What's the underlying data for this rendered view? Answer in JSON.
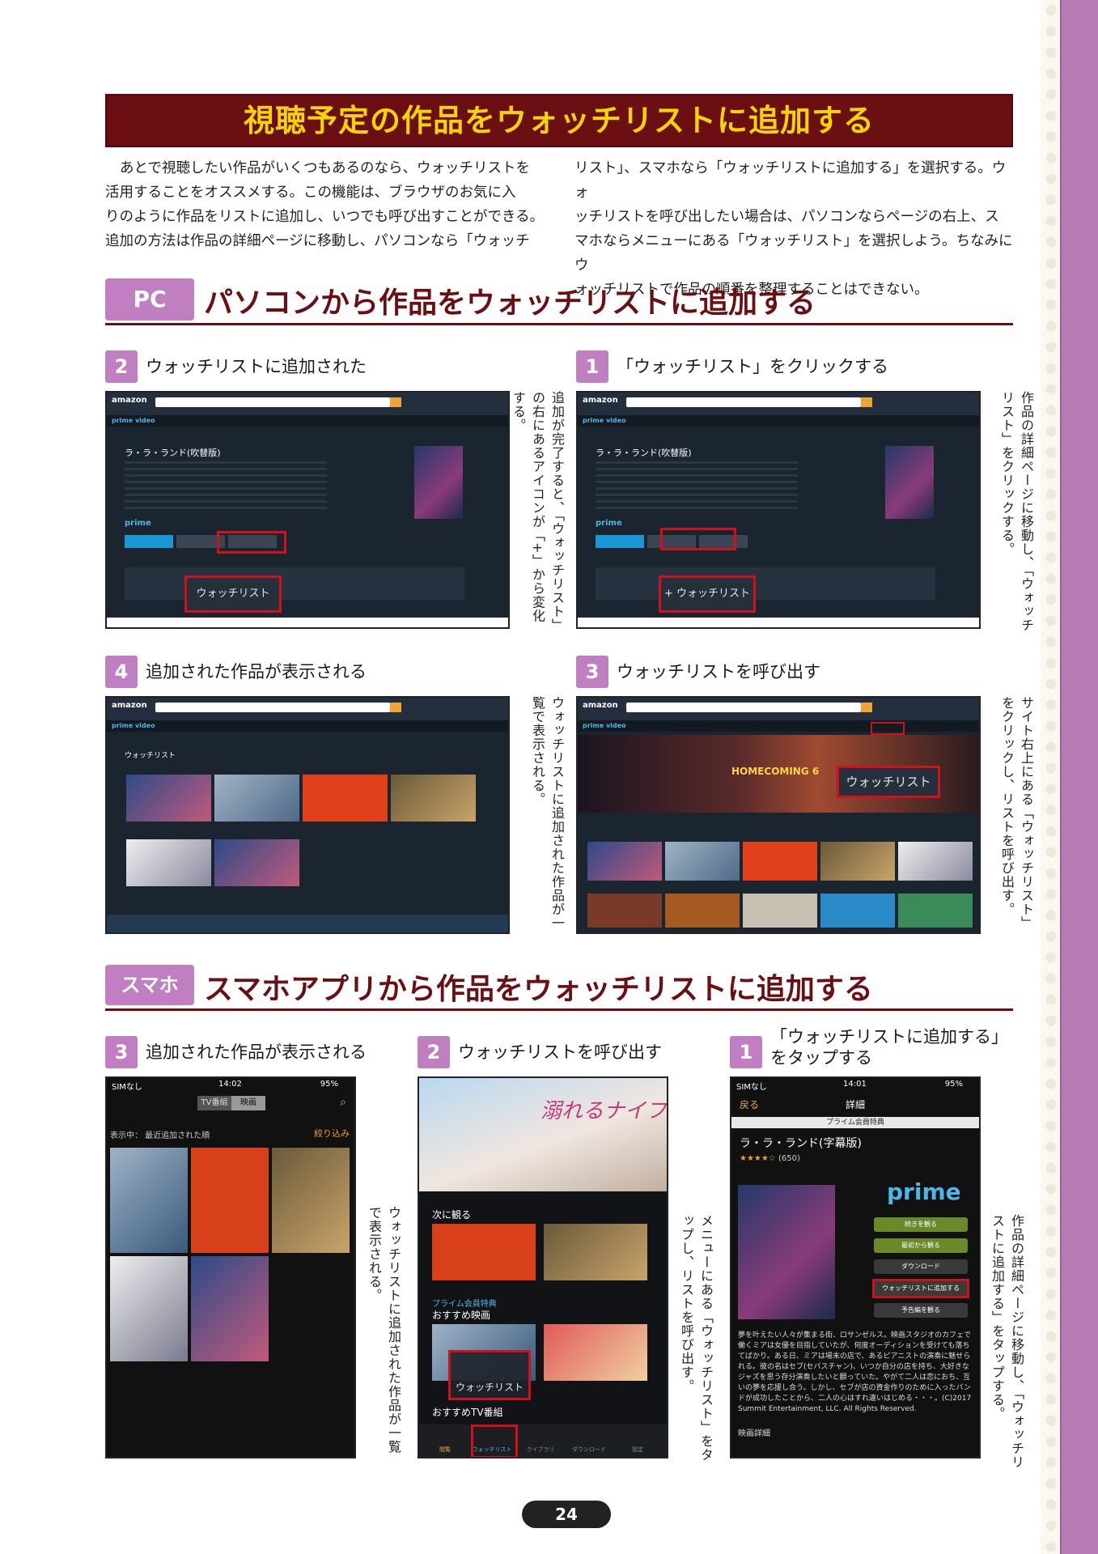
{
  "colors": {
    "banner_bg": "#6b0f13",
    "banner_text": "#f5d500",
    "badge": "#c07fc0",
    "accent_red": "#d0101a",
    "right_band": "#b77bb6"
  },
  "header": {
    "title": "視聴予定の作品をウォッチリストに追加する"
  },
  "intro": {
    "left": [
      "あとで視聴したい作品がいくつもあるのなら、ウォッチリストを",
      "活用することをオススメする。この機能は、ブラウザのお気に入",
      "りのように作品をリストに追加し、いつでも呼び出すことができる。",
      "追加の方法は作品の詳細ページに移動し、パソコンなら「ウォッチ"
    ],
    "right": [
      "リスト」、スマホなら「ウォッチリストに追加する」を選択する。ウォ",
      "ッチリストを呼び出したい場合は、パソコンならページの右上、ス",
      "マホならメニューにある「ウォッチリスト」を選択しよう。ちなみにウ",
      "ォッチリストで作品の順番を整理することはできない。"
    ]
  },
  "pc_section": {
    "badge": "PC",
    "title": "パソコンから作品をウォッチリストに追加する",
    "steps": [
      {
        "num": "1",
        "label": "「ウォッチリスト」をクリックする",
        "note": "作品の詳細ページに移動し、「ウォッチリスト」をクリックする。",
        "callout": "+ ウォッチリスト"
      },
      {
        "num": "2",
        "label": "ウォッチリストに追加された",
        "note": "追加が完了すると、「ウォッチリスト」の右にあるアイコンが「+」から変化する。",
        "callout": "ウォッチリスト"
      },
      {
        "num": "3",
        "label": "ウォッチリストを呼び出す",
        "note": "サイト右上にある「ウォッチリスト」をクリックし、リストを呼び出す。",
        "callout": "ウォッチリスト"
      },
      {
        "num": "4",
        "label": "追加された作品が表示される",
        "note": "ウォッチリストに追加された作品が一覧で表示される。"
      }
    ],
    "screen": {
      "logo": "amazon",
      "prime_video": "prime video",
      "movie_title": "ラ・ラ・ランド(吹替版)",
      "prime": "prime",
      "watchlist_heading": "ウォッチリスト",
      "banner_title": "HOMECOMING 6"
    }
  },
  "sp_section": {
    "badge": "スマホ",
    "title": "スマホアプリから作品をウォッチリストに追加する",
    "steps": [
      {
        "num": "1",
        "label_line1": "「ウォッチリストに追加する」",
        "label_line2": "をタップする",
        "note": "作品の詳細ページに移動し、「ウォッチリストに追加する」をタップする。"
      },
      {
        "num": "2",
        "label": "ウォッチリストを呼び出す",
        "note": "メニューにある「ウォッチリスト」をタップし、リストを呼び出す。"
      },
      {
        "num": "3",
        "label": "追加された作品が表示される",
        "note": "ウォッチリストに追加された作品が一覧で表示される。"
      }
    ],
    "phone3": {
      "carrier": "SIMなし",
      "time": "14:02",
      "battery": "95%",
      "tab_tv": "TV番組",
      "tab_movie": "映画",
      "filter_text": "表示中： 最近追加された順",
      "filter_btn": "絞り込み"
    },
    "phone2": {
      "hero_title": "溺れるナイフ",
      "next": "次に観る",
      "prime_benefit": "プライム会員特典",
      "rec_movies": "おすすめ映画",
      "rec_tv": "おすすめTV番組",
      "callout": "ウォッチリスト",
      "tabs": [
        "閲覧",
        "ウォッチリスト",
        "ライブラリ",
        "ダウンロード",
        "設定"
      ]
    },
    "phone1": {
      "carrier": "SIMなし",
      "time": "14:01",
      "battery": "95%",
      "back": "戻る",
      "header": "詳細",
      "prime_tag": "プライム会員特典",
      "title": "ラ・ラ・ランド(字幕版)",
      "rating": "(650)",
      "prime": "prime",
      "buttons": [
        "続きを観る",
        "最初から観る",
        "ダウンロード",
        "ウォッチリストに追加する",
        "予告編を観る"
      ],
      "synopsis": "夢を叶えたい人々が集まる街、ロサンゼルス。映画スタジオのカフェで働くミアは女優を目指していたが、何度オーディションを受けても落ちてばかり。ある日、ミアは場末の店で、あるピアニストの演奏に魅せられる。彼の名はセブ(セバスチャン)、いつか自分の店を持ち、大好きなジャズを思う存分演奏したいと願っていた。やがて二人は恋におち、互いの夢を応援し合う。しかし、セブが店の資金作りのために入ったバンドが成功したことから、二人の心はすれ違いはじめる・・・。(C)2017 Summit Entertainment, LLC. All Rights Reserved.",
      "details": "映画詳細"
    }
  },
  "footer": {
    "page": "24"
  }
}
